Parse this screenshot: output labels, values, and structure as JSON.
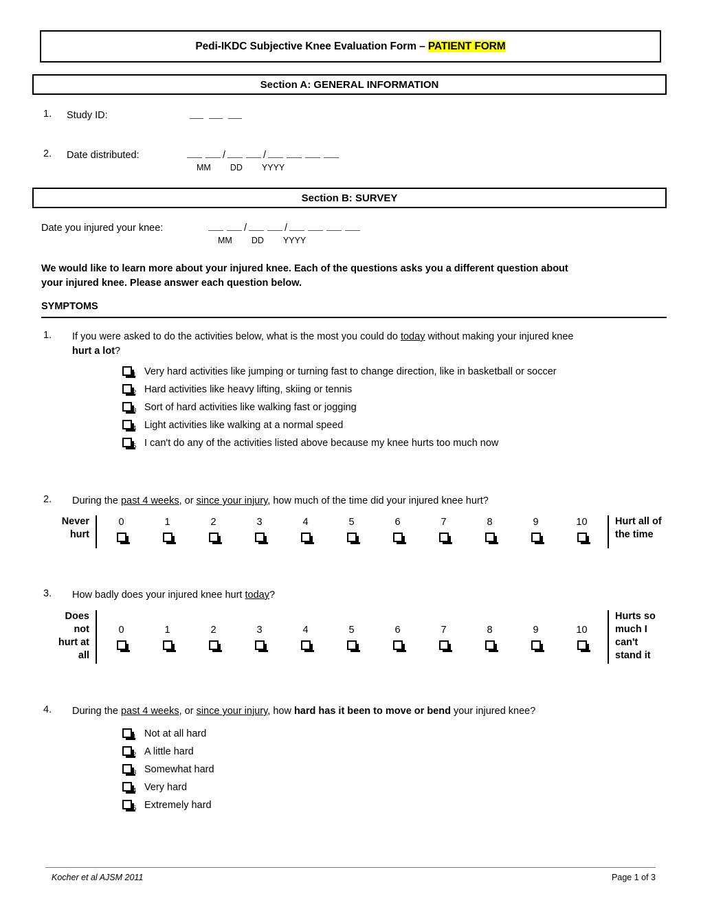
{
  "document": {
    "title_prefix": "Pedi-IKDC Subjective Knee Evaluation Form – ",
    "title_highlight": "PATIENT FORM",
    "highlight_color": "#ffff00"
  },
  "section_a": {
    "header": "Section A: GENERAL INFORMATION",
    "items": [
      {
        "number": "1.",
        "label": "Study ID:"
      },
      {
        "number": "2.",
        "label": "Date distributed:"
      }
    ],
    "date_labels": {
      "mm": "MM",
      "dd": "DD",
      "yyyy": "YYYY"
    },
    "slash": "/"
  },
  "section_b": {
    "header": "Section B: SURVEY",
    "injury_date_label": "Date you injured your knee:",
    "date_labels": {
      "mm": "MM",
      "dd": "DD",
      "yyyy": "YYYY"
    },
    "intro_line1": "We would like to learn more about your injured knee.  Each of the questions asks you a different question about",
    "intro_line2": "your injured knee.  Please answer each question below.",
    "symptoms_header": "SYMPTOMS"
  },
  "questions": [
    {
      "number": "1.",
      "type": "options",
      "text_part1": "If you were asked to do the activities below, what is the most you could do ",
      "text_underlined": "today",
      "text_part2": " without making your injured knee",
      "text_line2_bold": "hurt a lot",
      "text_line2_tail": "?",
      "options": [
        {
          "sub": "1",
          "label": "Very hard activities like jumping or turning fast to change direction, like in basketball or soccer"
        },
        {
          "sub": "2",
          "label": "Hard activities like heavy lifting, skiing or tennis"
        },
        {
          "sub": "3",
          "label": "Sort of hard activities like walking fast or jogging"
        },
        {
          "sub": "4",
          "label": "Light activities like walking at a normal speed"
        },
        {
          "sub": "5",
          "label": "I can't do any of the activities listed above because my knee hurts too much now"
        }
      ]
    },
    {
      "number": "2.",
      "type": "scale",
      "text_part1": "During the ",
      "text_u1": "past 4 weeks",
      "text_part2": ", or ",
      "text_u2": "since your injury",
      "text_part3": ", how much of the time did your injured knee hurt?",
      "left_label_lines": [
        "Never",
        "hurt"
      ],
      "right_label_lines": [
        "Hurt all of",
        "the time"
      ],
      "values": [
        "0",
        "1",
        "2",
        "3",
        "4",
        "5",
        "6",
        "7",
        "8",
        "9",
        "10"
      ]
    },
    {
      "number": "3.",
      "type": "scale",
      "text_part1": "How badly does your injured knee hurt ",
      "text_u1": "today",
      "text_part2": "?",
      "left_label_lines": [
        "Does",
        "not",
        "hurt at",
        "all"
      ],
      "right_label_lines": [
        "Hurts so",
        "much I",
        "can't",
        "stand it"
      ],
      "values": [
        "0",
        "1",
        "2",
        "3",
        "4",
        "5",
        "6",
        "7",
        "8",
        "9",
        "10"
      ]
    },
    {
      "number": "4.",
      "type": "options",
      "text_part1": "During the ",
      "text_u1": "past 4 weeks",
      "text_part2": ", or ",
      "text_u2": "since your injury",
      "text_part3": ", how ",
      "text_bold": "hard has it been to move or bend",
      "text_part4": " your injured knee?",
      "options": [
        {
          "sub": "1",
          "label": "Not at all hard"
        },
        {
          "sub": "2",
          "label": "A little hard"
        },
        {
          "sub": "3",
          "label": "Somewhat hard"
        },
        {
          "sub": "4",
          "label": "Very hard"
        },
        {
          "sub": "5",
          "label": "Extremely hard"
        }
      ]
    }
  ],
  "footer": {
    "citation": "Kocher et al AJSM 2011",
    "page": "Page 1 of 3"
  }
}
